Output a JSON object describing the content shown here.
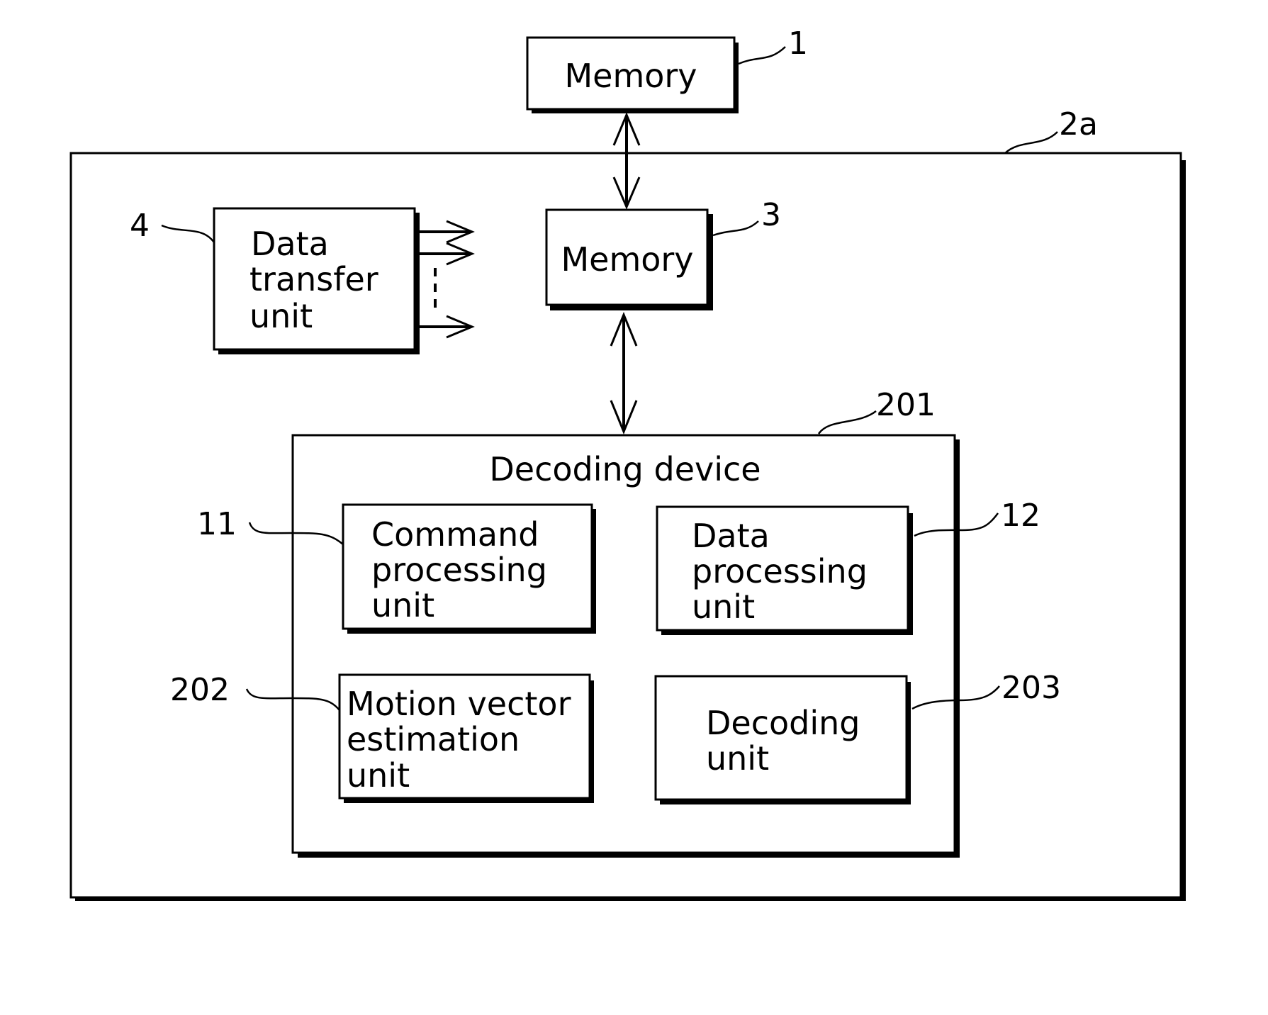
{
  "diagram": {
    "external_memory": {
      "ref": "1",
      "label": "Memory"
    },
    "system": {
      "ref": "2a"
    },
    "data_transfer_unit": {
      "ref": "4",
      "lines": [
        "Data",
        "transfer",
        "unit"
      ]
    },
    "internal_memory": {
      "ref": "3",
      "label": "Memory"
    },
    "decoding_device": {
      "ref": "201",
      "title": "Decoding device",
      "command_processing_unit": {
        "ref": "11",
        "lines": [
          "Command",
          "processing",
          "unit"
        ]
      },
      "data_processing_unit": {
        "ref": "12",
        "lines": [
          "Data",
          "processing",
          "unit"
        ]
      },
      "motion_vector_estimation_unit": {
        "ref": "202",
        "lines": [
          "Motion vector",
          "estimation",
          "unit"
        ]
      },
      "decoding_unit": {
        "ref": "203",
        "lines": [
          "Decoding",
          "unit"
        ]
      }
    }
  }
}
